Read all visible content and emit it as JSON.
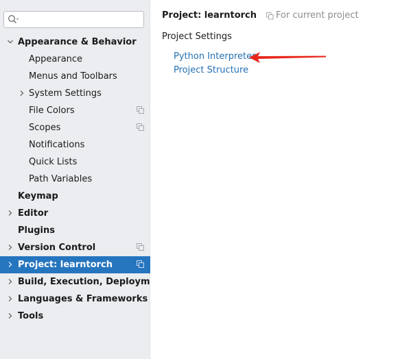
{
  "search": {
    "value": "",
    "placeholder": ""
  },
  "sidebar": {
    "items": [
      {
        "label": "Appearance & Behavior",
        "level": 0,
        "expanded": true,
        "bold": true,
        "copy": false
      },
      {
        "label": "Appearance",
        "level": 1,
        "bold": false,
        "copy": false
      },
      {
        "label": "Menus and Toolbars",
        "level": 1,
        "bold": false,
        "copy": false
      },
      {
        "label": "System Settings",
        "level": 1,
        "expandable": true,
        "bold": false,
        "copy": false
      },
      {
        "label": "File Colors",
        "level": 1,
        "bold": false,
        "copy": true
      },
      {
        "label": "Scopes",
        "level": 1,
        "bold": false,
        "copy": true
      },
      {
        "label": "Notifications",
        "level": 1,
        "bold": false,
        "copy": false
      },
      {
        "label": "Quick Lists",
        "level": 1,
        "bold": false,
        "copy": false
      },
      {
        "label": "Path Variables",
        "level": 1,
        "bold": false,
        "copy": false
      },
      {
        "label": "Keymap",
        "level": 0,
        "bold": true,
        "copy": false
      },
      {
        "label": "Editor",
        "level": 0,
        "expandable": true,
        "bold": true,
        "copy": false
      },
      {
        "label": "Plugins",
        "level": 0,
        "bold": true,
        "copy": false
      },
      {
        "label": "Version Control",
        "level": 0,
        "expandable": true,
        "bold": true,
        "copy": true
      },
      {
        "label": "Project: learntorch",
        "level": 0,
        "expandable": true,
        "bold": true,
        "copy": true,
        "selected": true
      },
      {
        "label": "Build, Execution, Deployment",
        "level": 0,
        "expandable": true,
        "bold": true,
        "copy": false
      },
      {
        "label": "Languages & Frameworks",
        "level": 0,
        "expandable": true,
        "bold": true,
        "copy": false
      },
      {
        "label": "Tools",
        "level": 0,
        "expandable": true,
        "bold": true,
        "copy": false
      }
    ]
  },
  "content": {
    "title": "Project: learntorch",
    "scope_hint": "For current project",
    "section_label": "Project Settings",
    "links": {
      "interpreter": "Python Interpreter",
      "structure": "Project Structure"
    }
  },
  "colors": {
    "selection": "#2675bf",
    "link": "#2470b3",
    "annotation_arrow": "#e8261c",
    "sidebar_bg": "#ebedf0"
  },
  "icons": {
    "search": "search-icon",
    "chevron_down": "chevron-down-icon",
    "chevron_right": "chevron-right-icon",
    "copy": "project-level-icon"
  }
}
